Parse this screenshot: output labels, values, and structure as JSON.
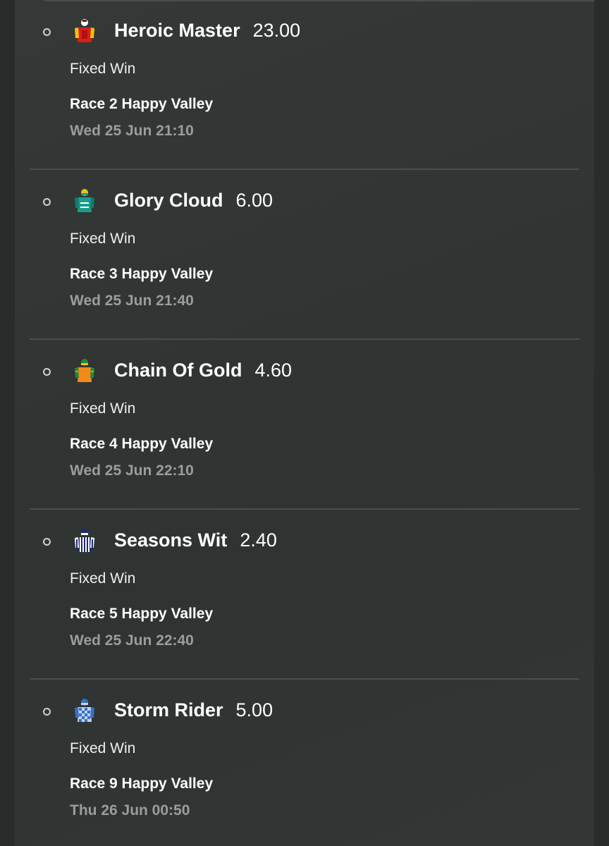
{
  "colors": {
    "background": "#292c2b",
    "panel": "#323634",
    "divider": "#4a4e4c",
    "text_primary": "#ffffff",
    "text_muted": "#9a9d9b"
  },
  "bets": [
    {
      "runner": "Heroic Master",
      "odds": "23.00",
      "bet_type": "Fixed Win",
      "race": "Race 2 Happy Valley",
      "time": "Wed 25 Jun 21:10",
      "silk_icon": "jockey-silk-red-yellow-icon",
      "silk_colors": [
        "#d81e1e",
        "#f5c400"
      ]
    },
    {
      "runner": "Glory Cloud",
      "odds": "6.00",
      "bet_type": "Fixed Win",
      "race": "Race 3 Happy Valley",
      "time": "Wed 25 Jun 21:40",
      "silk_icon": "jockey-silk-teal-icon",
      "silk_colors": [
        "#1a9c8c",
        "#e8c21a"
      ]
    },
    {
      "runner": "Chain Of Gold",
      "odds": "4.60",
      "bet_type": "Fixed Win",
      "race": "Race 4 Happy Valley",
      "time": "Wed 25 Jun 22:10",
      "silk_icon": "jockey-silk-orange-green-icon",
      "silk_colors": [
        "#f08a1c",
        "#1f8a3a"
      ]
    },
    {
      "runner": "Seasons Wit",
      "odds": "2.40",
      "bet_type": "Fixed Win",
      "race": "Race 5 Happy Valley",
      "time": "Wed 25 Jun 22:40",
      "silk_icon": "jockey-silk-navy-stripes-icon",
      "silk_colors": [
        "#1c2a6e",
        "#ffffff"
      ]
    },
    {
      "runner": "Storm Rider",
      "odds": "5.00",
      "bet_type": "Fixed Win",
      "race": "Race 9 Happy Valley",
      "time": "Thu 26 Jun 00:50",
      "silk_icon": "jockey-silk-blue-check-icon",
      "silk_colors": [
        "#3a6fc4",
        "#bcd4f2"
      ]
    }
  ]
}
